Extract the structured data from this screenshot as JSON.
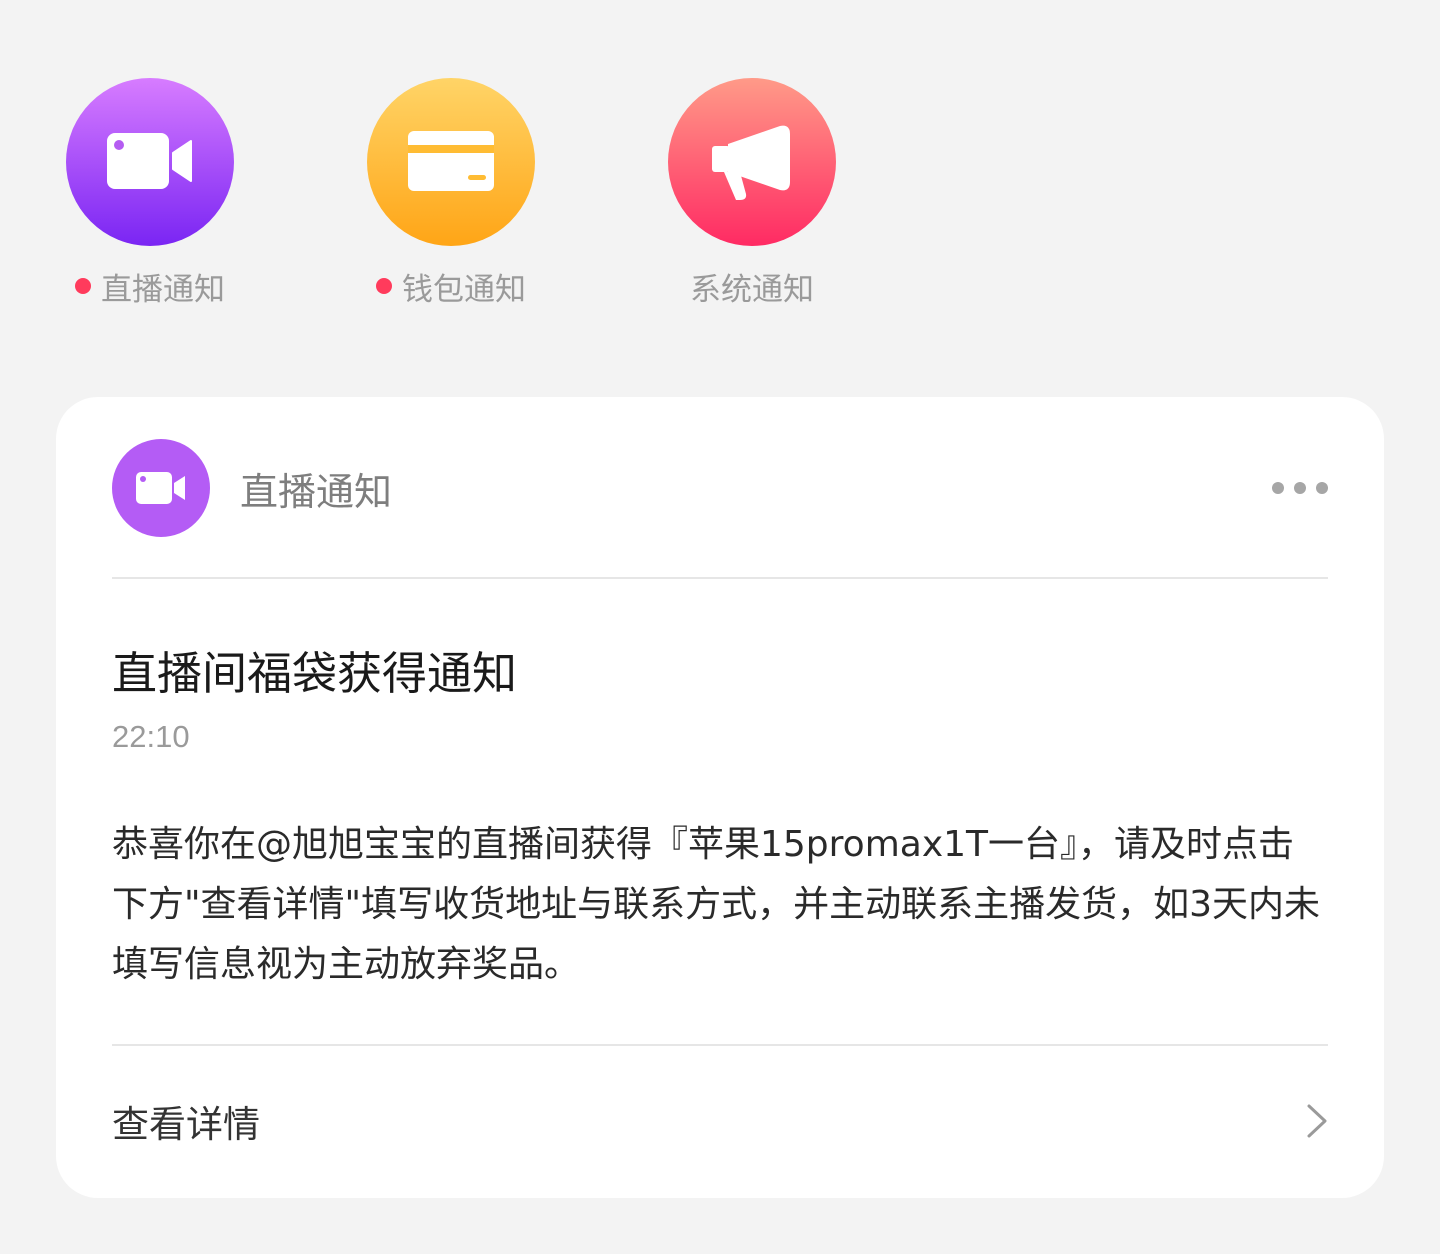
{
  "categories": [
    {
      "label": "直播通知",
      "icon": "video-camera-icon",
      "unread": true,
      "color_top": "#d77cff",
      "color_bottom": "#7a25f3"
    },
    {
      "label": "钱包通知",
      "icon": "wallet-card-icon",
      "unread": true,
      "color_top": "#ffd467",
      "color_bottom": "#ffa516"
    },
    {
      "label": "系统通知",
      "icon": "megaphone-icon",
      "unread": false,
      "color_top": "#ff9a88",
      "color_bottom": "#ff2a63"
    }
  ],
  "card": {
    "source": "直播通知",
    "source_icon": "video-camera-icon",
    "more_icon": "more-dots-icon",
    "title": "直播间福袋获得通知",
    "time": "22:10",
    "body": "恭喜你在@旭旭宝宝的直播间获得『苹果15promax1T一台』，请及时点击下方\"查看详情\"填写收货地址与联系方式，并主动联系主播发货，如3天内未填写信息视为主动放弃奖品。",
    "action_label": "查看详情",
    "action_icon": "chevron-right-icon"
  },
  "colors": {
    "unread_dot": "#ff3b5c",
    "background": "#f3f3f3",
    "card_avatar": "#b45cf5"
  }
}
